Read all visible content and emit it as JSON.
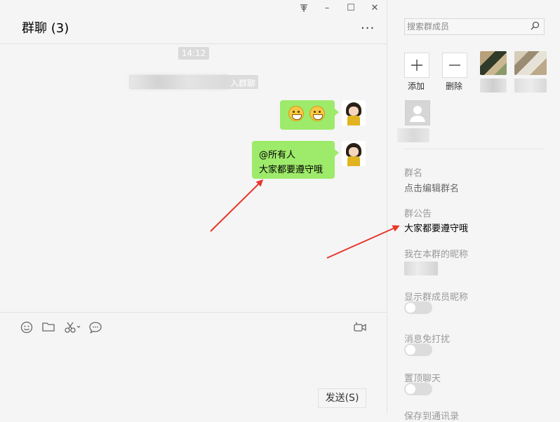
{
  "window": {
    "pin_icon": "pin-icon",
    "min_label": "–",
    "max_label": "☐",
    "close_label": "✕"
  },
  "chat": {
    "title": "群聊 (3)",
    "more_label": "···",
    "time": "14:12",
    "system_note_suffix": "入群聊",
    "messages": [
      {
        "type": "emoji",
        "content": [
          "grinning-face",
          "grinning-face"
        ]
      },
      {
        "type": "text",
        "lines": [
          "@所有人",
          "大家都要遵守哦"
        ]
      }
    ]
  },
  "toolbar": {
    "items": [
      "emoji-icon",
      "folder-icon",
      "scissors-icon",
      "chat-bubble-icon",
      "video-call-icon"
    ],
    "send_label": "发送(S)"
  },
  "info_panel": {
    "search_placeholder": "搜索群成员",
    "add_label": "添加",
    "remove_label": "删除",
    "group_name_label": "群名",
    "group_name_value": "点击编辑群名",
    "announcement_label": "群公告",
    "announcement_value": "大家都要遵守哦",
    "my_nickname_label": "我在本群的昵称",
    "show_nicknames_label": "显示群成员昵称",
    "show_nicknames_on": false,
    "mute_label": "消息免打扰",
    "mute_on": false,
    "pin_label": "置顶聊天",
    "pin_on": false,
    "save_contacts_label": "保存到通讯录"
  },
  "colors": {
    "bubble": "#9eea6a",
    "arrow": "#e8372c",
    "background": "#f5f5f5"
  }
}
